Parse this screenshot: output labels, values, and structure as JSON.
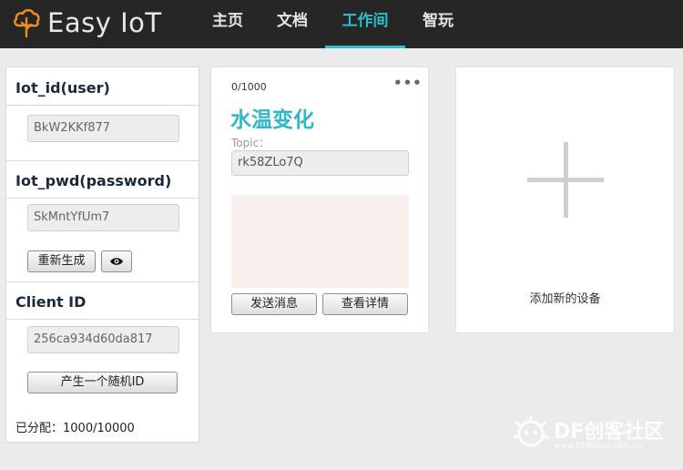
{
  "app": {
    "logo_text": "Easy IoT"
  },
  "nav": {
    "items": [
      {
        "label": "主页"
      },
      {
        "label": "文档"
      },
      {
        "label": "工作间"
      },
      {
        "label": "智玩"
      }
    ],
    "active": "工作间",
    "accent_color": "#2dbfd0"
  },
  "credentials": {
    "iot_id_heading": "Iot_id(user)",
    "iot_id_value": "BkW2KKf877",
    "iot_pwd_heading": "Iot_pwd(password)",
    "iot_pwd_value": "SkMntYfUm7",
    "regenerate_label": "重新生成",
    "client_id_heading": "Client ID",
    "client_id_value": "256ca934d60da817",
    "random_id_label": "产生一个随机ID",
    "allocated_text": "已分配：1000/10000"
  },
  "device": {
    "counter": "0/1000",
    "more_label": "•••",
    "title": "水温变化",
    "topic_label": "Topic：",
    "topic_value": "rk58ZLo7Q",
    "send_label": "发送消息",
    "details_label": "查看详情",
    "title_color": "#2eb8c8"
  },
  "add_device": {
    "label": "添加新的设备"
  },
  "watermark": {
    "main": "DF创客社区",
    "sub": "www.DFRobot.com.cn"
  },
  "icons": {
    "logo": "cloud-tree-icon",
    "toggle_visibility": "eye-icon",
    "add": "plus-icon"
  }
}
